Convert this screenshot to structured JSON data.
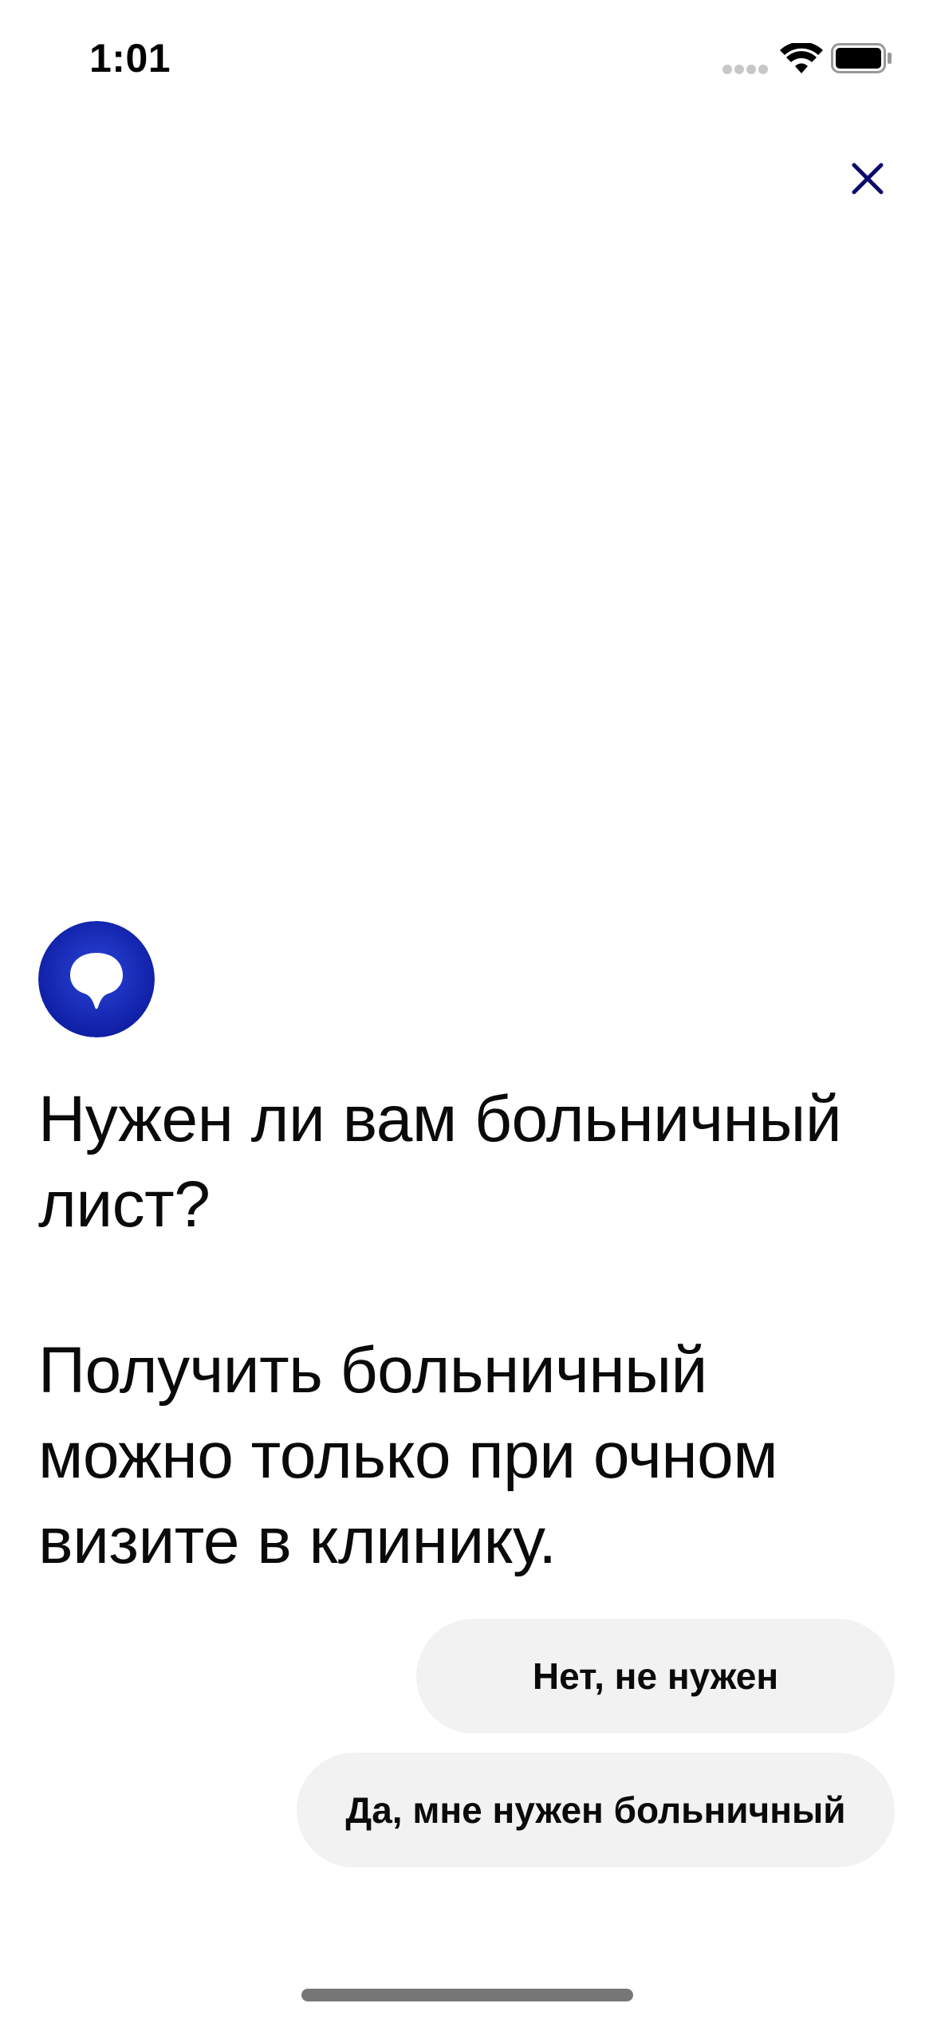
{
  "status_bar": {
    "time": "1:01",
    "signal_icon": "signal-dots-icon",
    "wifi_icon": "wifi-icon",
    "battery_icon": "battery-full-icon"
  },
  "header": {
    "close_icon": "close-icon",
    "accent_color": "#0a0a6b"
  },
  "chat": {
    "avatar_icon": "brand-logo-icon",
    "avatar_color": "#1a2fb3",
    "question": "Нужен ли вам больничный лист?",
    "info": "Получить больничный можно только при очном визите в клинику."
  },
  "replies": {
    "no_label": "Нет, не нужен",
    "yes_label": "Да, мне нужен больничный",
    "button_bg": "#f2f2f2"
  }
}
